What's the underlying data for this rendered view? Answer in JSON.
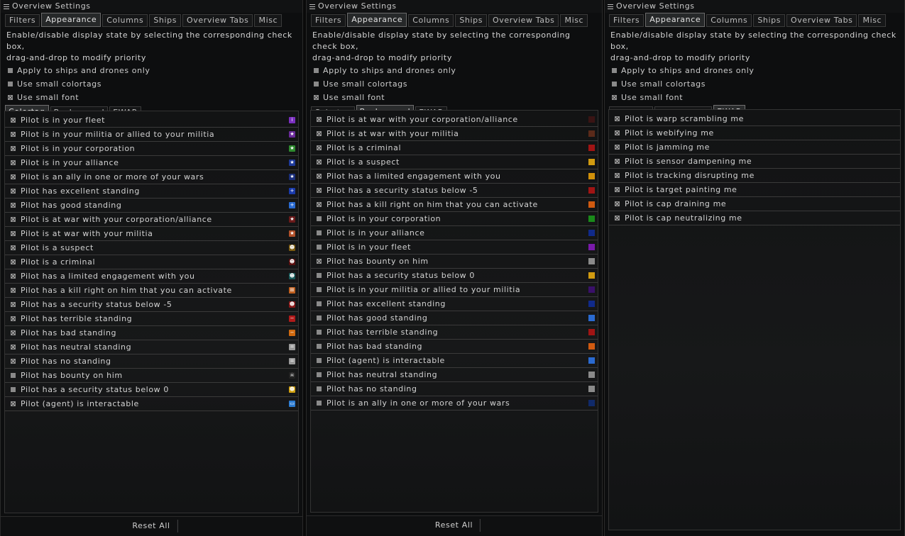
{
  "window_title": "Overview Settings",
  "tabs": [
    "Filters",
    "Appearance",
    "Columns",
    "Ships",
    "Overview Tabs",
    "Misc"
  ],
  "active_tab": "Appearance",
  "description": "Enable/disable display state by selecting the corresponding check box,\ndrag-and-drop to modify priority",
  "options": [
    {
      "label": "Apply to ships and drones only",
      "checked": false
    },
    {
      "label": "Use small colortags",
      "checked": false
    },
    {
      "label": "Use small font",
      "checked": true
    }
  ],
  "subtabs": [
    "Colortag",
    "Background",
    "EWAR"
  ],
  "reset_label": "Reset All",
  "panels": [
    {
      "active_subtab": "Colortag",
      "rows": [
        {
          "label": "Pilot is in your fleet",
          "checked": true,
          "color": "#7a2fbf",
          "icon": "fleet-icon",
          "glyph": "i"
        },
        {
          "label": "Pilot is in your militia or allied to your militia",
          "checked": true,
          "color": "#6a2a9a",
          "icon": "militia-star-icon",
          "glyph": "★"
        },
        {
          "label": "Pilot is in your corporation",
          "checked": true,
          "color": "#2e8a2e",
          "icon": "corporation-star-icon",
          "glyph": "★"
        },
        {
          "label": "Pilot is in your alliance",
          "checked": true,
          "color": "#1e3a9a",
          "icon": "alliance-star-icon",
          "glyph": "★"
        },
        {
          "label": "Pilot is an ally in one or more of your wars",
          "checked": true,
          "color": "#1a2e7a",
          "icon": "ally-star-icon",
          "glyph": "★"
        },
        {
          "label": "Pilot has excellent standing",
          "checked": true,
          "color": "#1a3aaa",
          "icon": "plus-icon",
          "glyph": "+"
        },
        {
          "label": "Pilot has good standing",
          "checked": true,
          "color": "#2a6ad0",
          "icon": "plus-icon",
          "glyph": "+"
        },
        {
          "label": "Pilot is at war with your corporation/alliance",
          "checked": true,
          "color": "#6a1a1a",
          "icon": "war-star-icon",
          "glyph": "★"
        },
        {
          "label": "Pilot is at war with your militia",
          "checked": true,
          "color": "#b0502a",
          "icon": "militia-war-star-icon",
          "glyph": "★"
        },
        {
          "label": "Pilot is a suspect",
          "checked": true,
          "color": "#7a5a10",
          "icon": "skull-icon",
          "glyph": "☻"
        },
        {
          "label": "Pilot is a criminal",
          "checked": true,
          "color": "#5a1010",
          "icon": "skull-icon",
          "glyph": "☻"
        },
        {
          "label": "Pilot has a limited engagement with you",
          "checked": true,
          "color": "#1a5a5a",
          "icon": "engagement-icon",
          "glyph": "☻"
        },
        {
          "label": "Pilot has a kill right on him that you can activate",
          "checked": true,
          "color": "#c06020",
          "icon": "killright-icon",
          "glyph": "⊞"
        },
        {
          "label": "Pilot has a security status below -5",
          "checked": true,
          "color": "#8a1a1a",
          "icon": "skull-icon",
          "glyph": "☻"
        },
        {
          "label": "Pilot has terrible standing",
          "checked": true,
          "color": "#b01a1a",
          "icon": "minus-icon",
          "glyph": "−"
        },
        {
          "label": "Pilot has bad standing",
          "checked": true,
          "color": "#d06a10",
          "icon": "minus-icon",
          "glyph": "−"
        },
        {
          "label": "Pilot has neutral standing",
          "checked": true,
          "color": "#9a9a9a",
          "icon": "equals-icon",
          "glyph": "="
        },
        {
          "label": "Pilot has no standing",
          "checked": true,
          "color": "#9a9a9a",
          "icon": "equals-icon",
          "glyph": "="
        },
        {
          "label": "Pilot has bounty on him",
          "checked": false,
          "color": "#222222",
          "icon": "skull-icon",
          "glyph": "☠"
        },
        {
          "label": "Pilot has a security status below 0",
          "checked": false,
          "color": "#d0a010",
          "icon": "skull-icon",
          "glyph": "☻"
        },
        {
          "label": "Pilot (agent) is interactable",
          "checked": true,
          "color": "#2a7ad0",
          "icon": "speech-bubble-icon",
          "glyph": "▭"
        }
      ]
    },
    {
      "active_subtab": "Background",
      "rows": [
        {
          "label": "Pilot is at war with your corporation/alliance",
          "checked": true,
          "color": "#3a1414"
        },
        {
          "label": "Pilot is at war with your militia",
          "checked": true,
          "color": "#5a2a1a"
        },
        {
          "label": "Pilot is a criminal",
          "checked": true,
          "color": "#a01414"
        },
        {
          "label": "Pilot is a suspect",
          "checked": true,
          "color": "#d09a10"
        },
        {
          "label": "Pilot has a limited engagement with you",
          "checked": true,
          "color": "#d0900a"
        },
        {
          "label": "Pilot has a security status below -5",
          "checked": true,
          "color": "#a01414"
        },
        {
          "label": "Pilot has a kill right on him that you can activate",
          "checked": true,
          "color": "#d05a10"
        },
        {
          "label": "Pilot is in your corporation",
          "checked": false,
          "color": "#1a8a1a"
        },
        {
          "label": "Pilot is in your alliance",
          "checked": false,
          "color": "#102a8a"
        },
        {
          "label": "Pilot is in your fleet",
          "checked": false,
          "color": "#7a1aaa"
        },
        {
          "label": "Pilot has bounty on him",
          "checked": true,
          "color": "#8a8a8a"
        },
        {
          "label": "Pilot has a security status below 0",
          "checked": false,
          "color": "#d09a10"
        },
        {
          "label": "Pilot is in your militia or allied to your militia",
          "checked": false,
          "color": "#3a106a"
        },
        {
          "label": "Pilot has excellent standing",
          "checked": false,
          "color": "#102a8a"
        },
        {
          "label": "Pilot has good standing",
          "checked": false,
          "color": "#2a6ad0"
        },
        {
          "label": "Pilot has terrible standing",
          "checked": false,
          "color": "#a01414"
        },
        {
          "label": "Pilot has bad standing",
          "checked": false,
          "color": "#d05a10"
        },
        {
          "label": "Pilot (agent) is interactable",
          "checked": false,
          "color": "#2a6ad0"
        },
        {
          "label": "Pilot has neutral standing",
          "checked": false,
          "color": "#8a8a8a"
        },
        {
          "label": "Pilot has no standing",
          "checked": false,
          "color": "#8a8a8a"
        },
        {
          "label": "Pilot is an ally in one or more of your wars",
          "checked": false,
          "color": "#102a6a"
        }
      ]
    },
    {
      "active_subtab": "EWAR",
      "rows": [
        {
          "label": "Pilot is warp scrambling me",
          "checked": true
        },
        {
          "label": "Pilot is webifying me",
          "checked": true
        },
        {
          "label": "Pilot is jamming me",
          "checked": true
        },
        {
          "label": "Pilot is sensor dampening me",
          "checked": true
        },
        {
          "label": "Pilot is tracking disrupting me",
          "checked": true
        },
        {
          "label": "Pilot is target painting me",
          "checked": true
        },
        {
          "label": "Pilot is cap draining me",
          "checked": true
        },
        {
          "label": "Pilot is cap neutralizing me",
          "checked": true
        }
      ]
    }
  ]
}
